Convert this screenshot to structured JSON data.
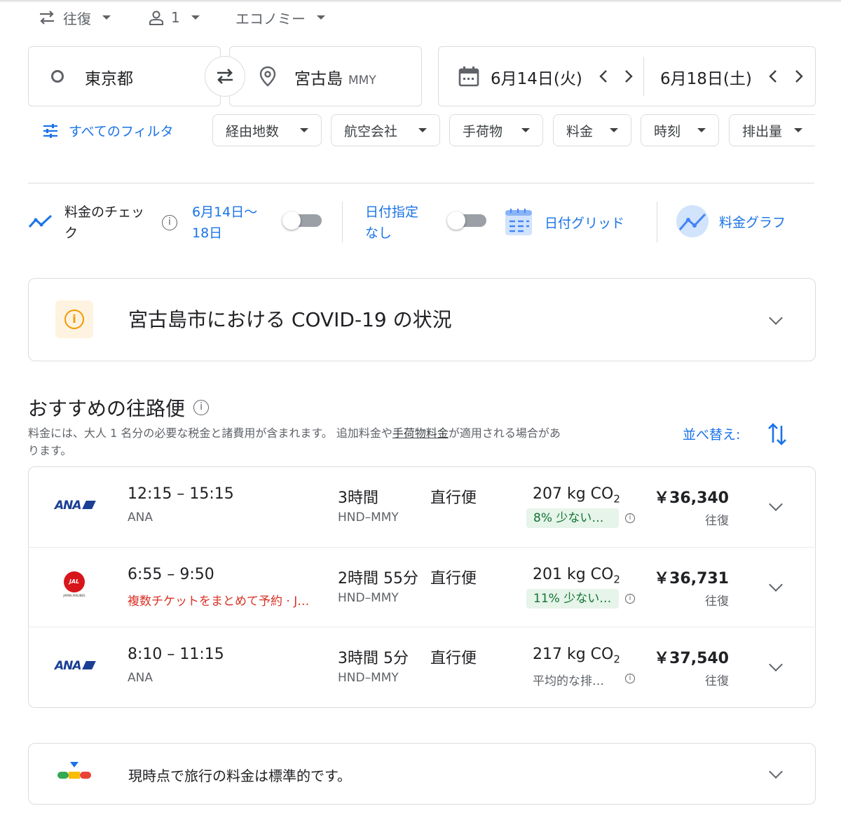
{
  "top_bar": {
    "trip_type": "往復",
    "passengers": "1",
    "cabin": "エコノミー"
  },
  "search": {
    "origin": "東京都",
    "destination": "宮古島",
    "destination_code": "MMY",
    "depart_date": "6月14日(火)",
    "return_date": "6月18日(土)"
  },
  "filters": {
    "all_filters": "すべてのフィルタ",
    "chips": [
      "経由地数",
      "航空会社",
      "手荷物",
      "料金",
      "時刻",
      "排出量"
    ]
  },
  "tracking": {
    "label_line1": "料金のチェッ",
    "label_line2": "ク",
    "date_line1": "6月14日〜",
    "date_line2": "18日",
    "any_dates_line1": "日付指定",
    "any_dates_line2": "なし",
    "date_grid": "日付グリッド",
    "price_graph": "料金グラフ"
  },
  "covid": {
    "title": "宮古島市における COVID-19 の状況"
  },
  "section": {
    "title": "おすすめの往路便",
    "note_line1_a": "料金には、大人 1 名分の必要な税金と諸費用が含まれます。 追加料金や",
    "note_link": "手荷物料金",
    "note_line1_b": "が適用される場合があ",
    "note_line2": "ります。",
    "sort_label": "並べ替え:"
  },
  "flights": [
    {
      "time": "12:15 – 15:15",
      "airline": "ANA",
      "duration": "3時間",
      "route": "HND–MMY",
      "stops": "直行便",
      "co2": "207 kg CO",
      "co2_note": "8% 少ない…",
      "price": "￥36,340",
      "price_type": "往復"
    },
    {
      "time": "6:55 – 9:50",
      "airline": "複数チケットをまとめて予約 · J…",
      "duration": "2時間 55分",
      "route": "HND–MMY",
      "stops": "直行便",
      "co2": "201 kg CO",
      "co2_note": "11% 少ない…",
      "price": "￥36,731",
      "price_type": "往復"
    },
    {
      "time": "8:10 – 11:15",
      "airline": "ANA",
      "duration": "3時間 5分",
      "route": "HND–MMY",
      "stops": "直行便",
      "co2": "217 kg CO",
      "co2_note": "平均的な排…",
      "price": "￥37,540",
      "price_type": "往復"
    }
  ],
  "logos": {
    "ana": "ANA",
    "jal": "JAL",
    "jal_sub": "JAPAN AIRLINES"
  },
  "co2_subscript": "2",
  "price_insight": "現時点で旅行の料金は標準的です。",
  "colors": {
    "accent": "#1a73e8",
    "warning": "#f29900",
    "green_badge": "#e6f4ea",
    "red_text": "#d93025"
  }
}
